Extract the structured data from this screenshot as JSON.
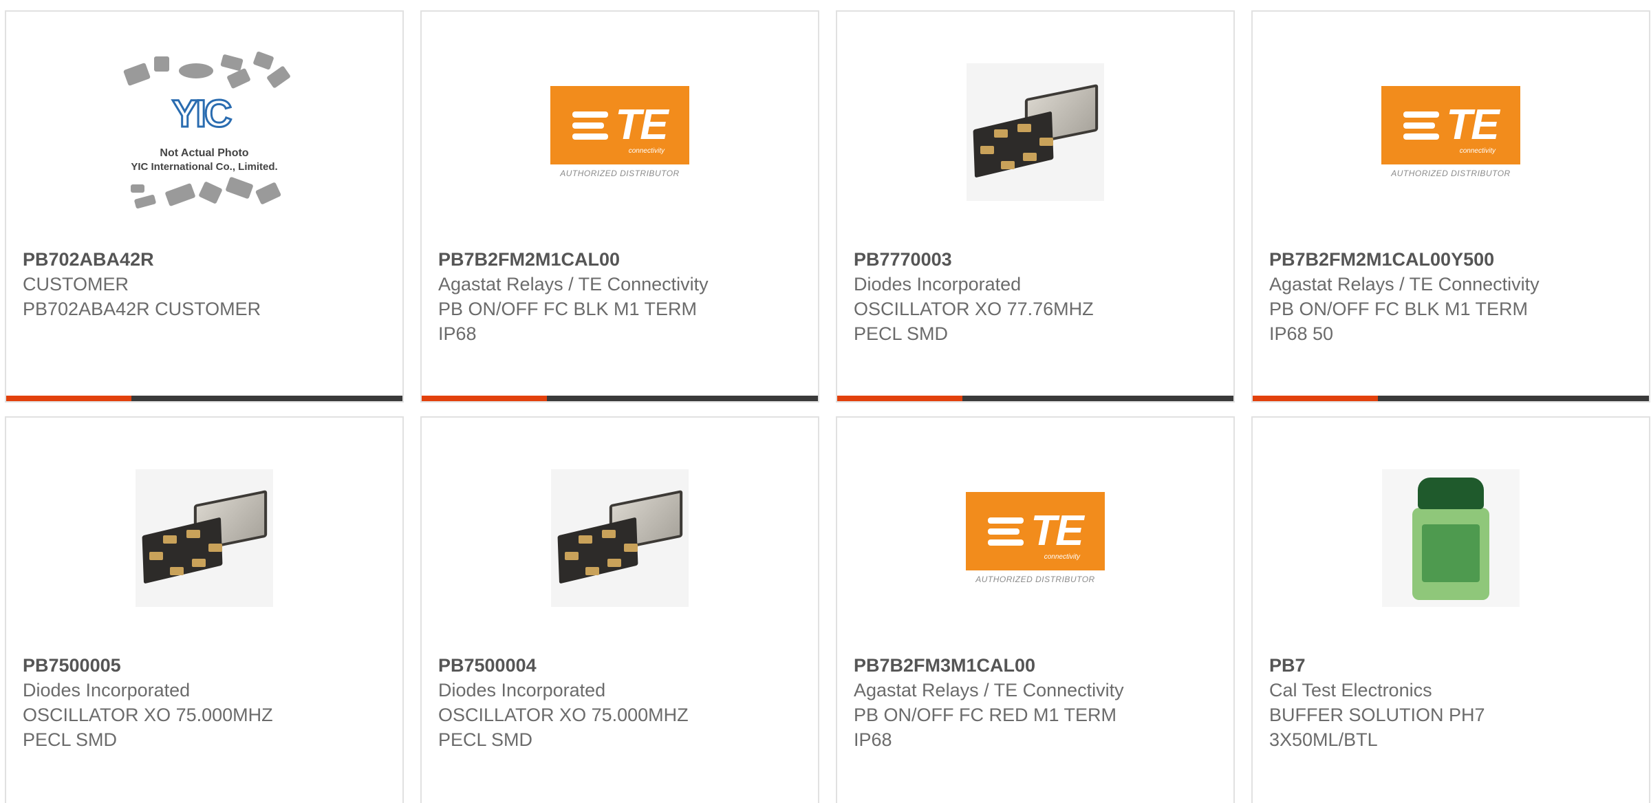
{
  "products": [
    {
      "part_number": "PB702ABA42R",
      "manufacturer": "CUSTOMER",
      "description": [
        "PB702ABA42R CUSTOMER"
      ],
      "image": "not-actual-photo"
    },
    {
      "part_number": "PB7B2FM2M1CAL00",
      "manufacturer": "Agastat Relays / TE Connectivity",
      "description": [
        "PB ON/OFF FC BLK M1 TERM",
        "IP68"
      ],
      "image": "te-logo"
    },
    {
      "part_number": "PB7770003",
      "manufacturer": "Diodes Incorporated",
      "description": [
        "OSCILLATOR XO 77.76MHZ",
        "PECL SMD"
      ],
      "image": "oscillator"
    },
    {
      "part_number": "PB7B2FM2M1CAL00Y500",
      "manufacturer": "Agastat Relays / TE Connectivity",
      "description": [
        "PB ON/OFF FC BLK M1 TERM",
        "IP68 50"
      ],
      "image": "te-logo"
    },
    {
      "part_number": "PB7500005",
      "manufacturer": "Diodes Incorporated",
      "description": [
        "OSCILLATOR XO 75.000MHZ",
        "PECL SMD"
      ],
      "image": "oscillator"
    },
    {
      "part_number": "PB7500004",
      "manufacturer": "Diodes Incorporated",
      "description": [
        "OSCILLATOR XO 75.000MHZ",
        "PECL SMD"
      ],
      "image": "oscillator"
    },
    {
      "part_number": "PB7B2FM3M1CAL00",
      "manufacturer": "Agastat Relays / TE Connectivity",
      "description": [
        "PB ON/OFF FC RED M1 TERM",
        "IP68"
      ],
      "image": "te-logo"
    },
    {
      "part_number": "PB7",
      "manufacturer": "Cal Test Electronics",
      "description": [
        "BUFFER SOLUTION PH7",
        "3X50ML/BTL"
      ],
      "image": "buffer-bottle"
    }
  ],
  "placeholder": {
    "logo": "YIC",
    "line1": "Not Actual Photo",
    "line2": "YIC International Co., Limited."
  },
  "te_logo": {
    "letters": "TE",
    "sub": "connectivity",
    "authorized": "AUTHORIZED DISTRIBUTOR"
  },
  "colors": {
    "accent": "#e2410c",
    "bar": "#3a3a3a",
    "te_orange": "#f28c1c"
  }
}
